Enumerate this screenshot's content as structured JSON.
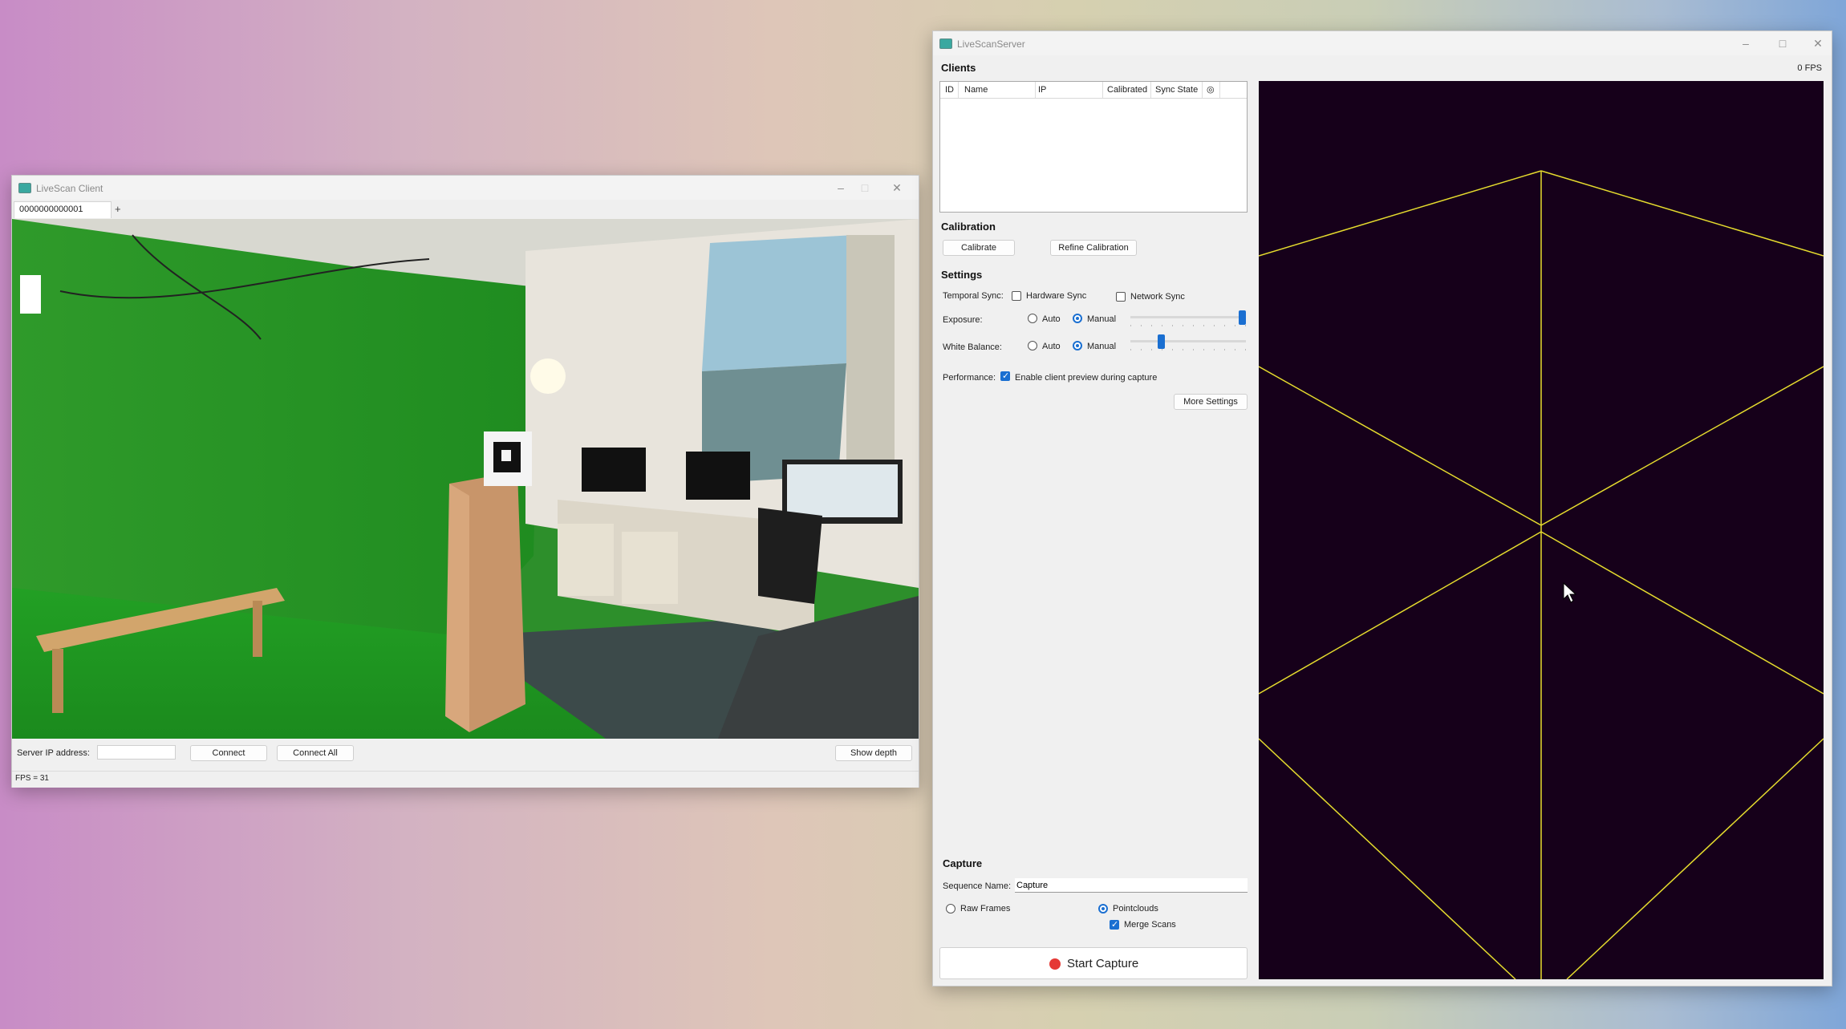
{
  "client_window": {
    "title": "LiveScan Client",
    "tab_label": "0000000000001",
    "add_tab": "+",
    "server_ip_label": "Server IP address:",
    "server_ip_value": "",
    "connect": "Connect",
    "connect_all": "Connect All",
    "show_depth": "Show depth",
    "fps_status": "FPS = 31"
  },
  "server_window": {
    "title": "LiveScanServer",
    "fps": "0 FPS",
    "clients": {
      "header": "Clients",
      "columns": [
        "ID",
        "Name",
        "IP",
        "Calibrated",
        "Sync State",
        "◎"
      ],
      "rows": []
    },
    "calibration": {
      "header": "Calibration",
      "calibrate": "Calibrate",
      "refine": "Refine Calibration"
    },
    "settings": {
      "header": "Settings",
      "temporal_sync_label": "Temporal Sync:",
      "hardware_sync": "Hardware Sync",
      "network_sync": "Network Sync",
      "exposure_label": "Exposure:",
      "white_balance_label": "White Balance:",
      "auto": "Auto",
      "manual": "Manual",
      "exposure_level": 1.0,
      "white_balance_level": 0.25,
      "performance_label": "Performance:",
      "enable_preview": "Enable client preview during capture",
      "more_settings": "More Settings"
    },
    "capture": {
      "header": "Capture",
      "sequence_name_label": "Sequence Name:",
      "sequence_name_value": "Capture",
      "raw_frames": "Raw Frames",
      "pointclouds": "Pointclouds",
      "merge_scans": "Merge Scans",
      "start_capture": "Start Capture"
    }
  },
  "colors": {
    "accent": "#1a6fd1",
    "viewport_bg": "#16001a",
    "grid_line": "#e6dc2e",
    "record_red": "#e53935"
  }
}
